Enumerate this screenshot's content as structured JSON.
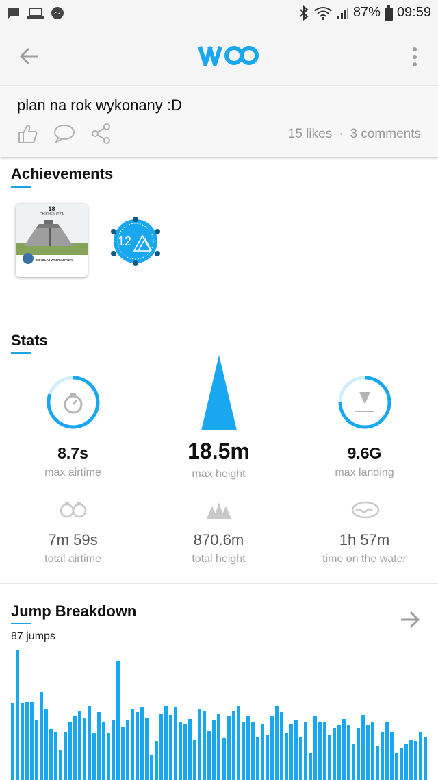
{
  "status_bar": {
    "battery": "87%",
    "time": "09:59"
  },
  "post": {
    "text": "plan na rok wykonany :D",
    "likes": "15 likes",
    "separator": "·",
    "comments": "3 comments"
  },
  "achievements": {
    "title": "Achievements",
    "card": {
      "number": "18",
      "place": "CHICHEN ITZA",
      "name": "MIKOLAJ WATRIABYNPL"
    },
    "badge": {
      "number": "12"
    }
  },
  "stats": {
    "title": "Stats",
    "primary": [
      {
        "value": "8.7s",
        "label": "max airtime",
        "icon": "stopwatch-icon"
      },
      {
        "value": "18.5m",
        "label": "max height",
        "icon": "triangle-icon"
      },
      {
        "value": "9.6G",
        "label": "max landing",
        "icon": "landing-icon"
      }
    ],
    "secondary": [
      {
        "value": "7m 59s",
        "label": "total airtime",
        "icon": "stopwatches-icon"
      },
      {
        "value": "870.6m",
        "label": "total height",
        "icon": "mountains-icon"
      },
      {
        "value": "1h 57m",
        "label": "time on the water",
        "icon": "waves-icon"
      }
    ]
  },
  "jump_breakdown": {
    "title": "Jump Breakdown",
    "count": "87 jumps",
    "bars": [
      0.59,
      1.0,
      0.59,
      0.6,
      0.6,
      0.46,
      0.68,
      0.54,
      0.39,
      0.37,
      0.23,
      0.37,
      0.45,
      0.49,
      0.53,
      0.48,
      0.57,
      0.36,
      0.52,
      0.44,
      0.36,
      0.46,
      0.91,
      0.41,
      0.46,
      0.55,
      0.52,
      0.56,
      0.48,
      0.19,
      0.3,
      0.51,
      0.57,
      0.5,
      0.56,
      0.44,
      0.43,
      0.47,
      0.31,
      0.55,
      0.53,
      0.38,
      0.46,
      0.51,
      0.32,
      0.49,
      0.53,
      0.57,
      0.44,
      0.49,
      0.44,
      0.33,
      0.43,
      0.35,
      0.49,
      0.57,
      0.52,
      0.36,
      0.43,
      0.46,
      0.33,
      0.44,
      0.21,
      0.49,
      0.44,
      0.44,
      0.34,
      0.4,
      0.42,
      0.47,
      0.42,
      0.28,
      0.4,
      0.5,
      0.42,
      0.44,
      0.26,
      0.37,
      0.45,
      0.37,
      0.21,
      0.25,
      0.28,
      0.31,
      0.3,
      0.37,
      0.33
    ]
  },
  "colors": {
    "accent": "#19a7ef",
    "bar_color": "#19a7ef"
  }
}
